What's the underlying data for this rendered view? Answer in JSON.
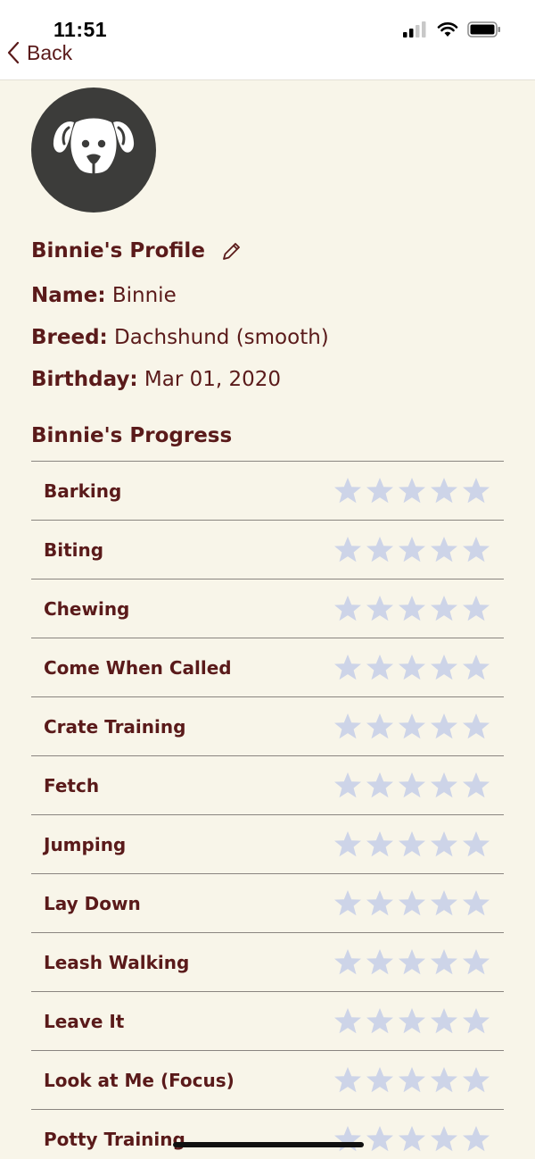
{
  "status_bar": {
    "time": "11:51"
  },
  "nav": {
    "back_label": "Back"
  },
  "profile": {
    "heading": "Binnie's Profile",
    "name_label": "Name:",
    "name_value": "Binnie",
    "breed_label": "Breed:",
    "breed_value": "Dachshund (smooth)",
    "birthday_label": "Birthday:",
    "birthday_value": "Mar 01, 2020"
  },
  "progress": {
    "heading": "Binnie's Progress",
    "star_color": "#cdd4e8",
    "items": [
      {
        "label": "Barking",
        "rating": 0
      },
      {
        "label": "Biting",
        "rating": 0
      },
      {
        "label": "Chewing",
        "rating": 0
      },
      {
        "label": "Come When Called",
        "rating": 0
      },
      {
        "label": "Crate Training",
        "rating": 0
      },
      {
        "label": "Fetch",
        "rating": 0
      },
      {
        "label": "Jumping",
        "rating": 0
      },
      {
        "label": "Lay Down",
        "rating": 0
      },
      {
        "label": "Leash Walking",
        "rating": 0
      },
      {
        "label": "Leave It",
        "rating": 0
      },
      {
        "label": "Look at Me (Focus)",
        "rating": 0
      },
      {
        "label": "Potty Training",
        "rating": 0
      }
    ]
  },
  "colors": {
    "text": "#5a1a1a",
    "background": "#f8f5e9",
    "avatar": "#3c3c3a"
  },
  "icons": [
    "chevron-left-icon",
    "dog-icon",
    "pencil-icon",
    "star-icon",
    "signal-icon",
    "wifi-icon",
    "battery-icon"
  ]
}
